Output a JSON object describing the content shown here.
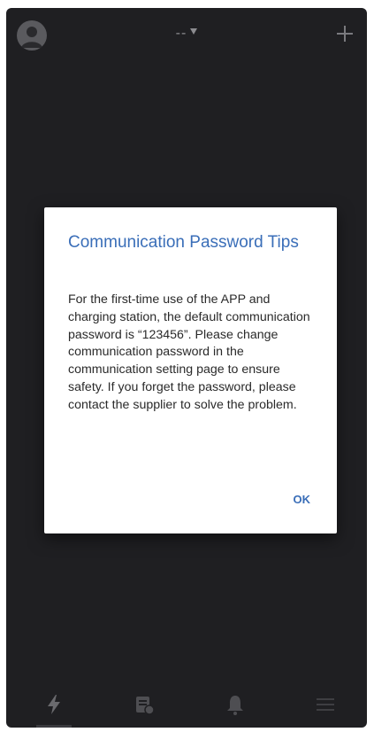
{
  "header": {
    "device_name": "--",
    "icons": {
      "avatar": "user-avatar-icon",
      "add": "plus-icon",
      "dropdown": "caret-down-icon"
    }
  },
  "dialog": {
    "title": "Communication Password Tips",
    "message": "For the first-time use of the APP and charging station, the default communication password is “123456”. Please change communication password in the communication setting page to ensure safety. If you forget the password, please contact the supplier to solve the problem.",
    "ok_label": "OK"
  },
  "bottom_nav": {
    "items": [
      {
        "icon": "lightning-icon",
        "active": true
      },
      {
        "icon": "records-icon",
        "active": false
      },
      {
        "icon": "bell-icon",
        "active": false
      },
      {
        "icon": "menu-icon",
        "active": false
      }
    ]
  },
  "colors": {
    "background": "#1f1f22",
    "dialog": "#ffffff",
    "accent": "#3a6eb8",
    "icon": "#5a5a5e"
  }
}
